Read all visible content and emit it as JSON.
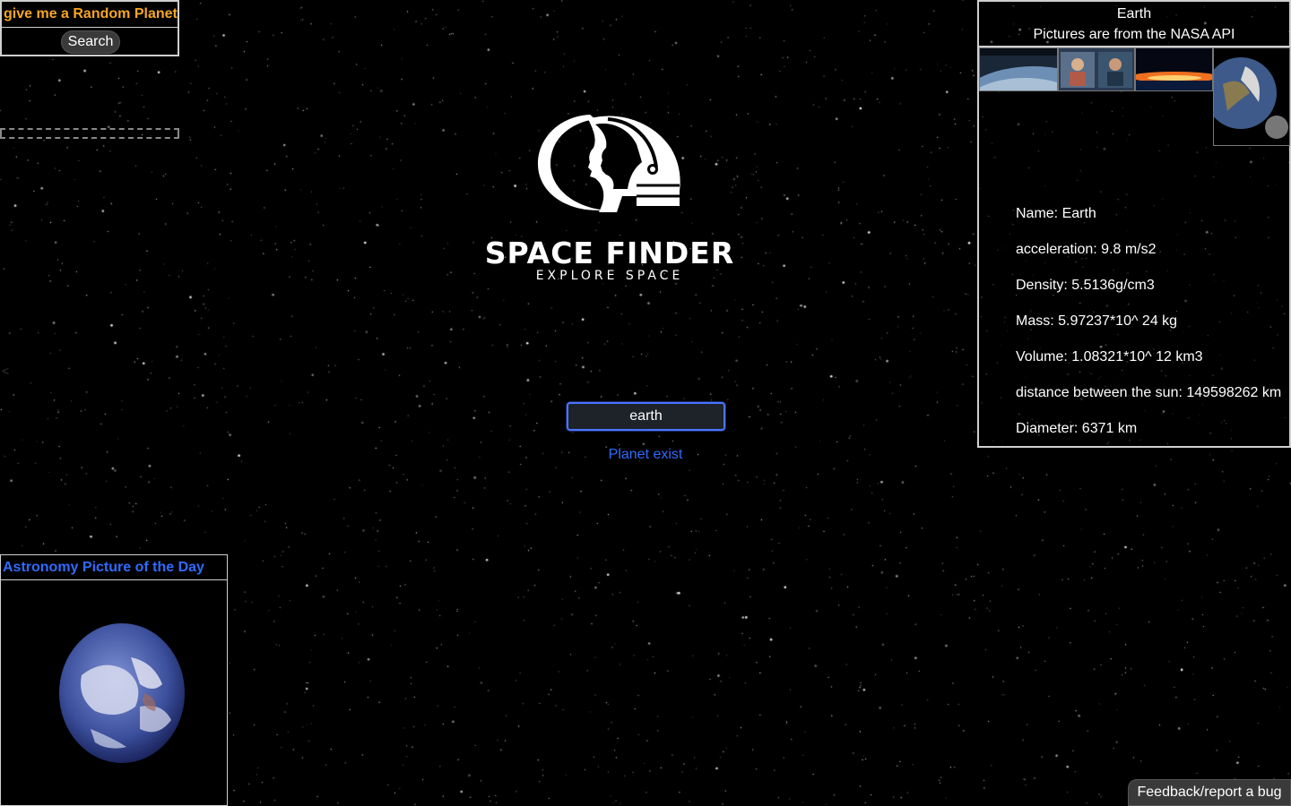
{
  "random_planet": {
    "title": "give me a Random Planet",
    "search_label": "Search"
  },
  "logo": {
    "title": "SPACE FINDER",
    "subtitle": "EXPLORE SPACE",
    "icon": "astronaut-helmet-icon"
  },
  "search": {
    "value": "earth",
    "status": "Planet exist",
    "status_color": "#2f6bff"
  },
  "info_panel": {
    "planet_name": "Earth",
    "credit": "Pictures are from the NASA API",
    "stats": [
      "Name: Earth",
      "acceleration: 9.8 m/s2",
      "Density: 5.5136g/cm3",
      "Mass: 5.97237*10^ 24 kg",
      "Volume: 1.08321*10^ 12 km3",
      "distance between the sun: 149598262 km",
      "Diameter: 6371 km"
    ]
  },
  "apod": {
    "title": "Astronomy Picture of the Day"
  },
  "feedback": {
    "label": "Feedback/report a bug"
  },
  "colors": {
    "background": "#000000",
    "accent_orange": "#f5a623",
    "accent_blue": "#2f6bff"
  }
}
